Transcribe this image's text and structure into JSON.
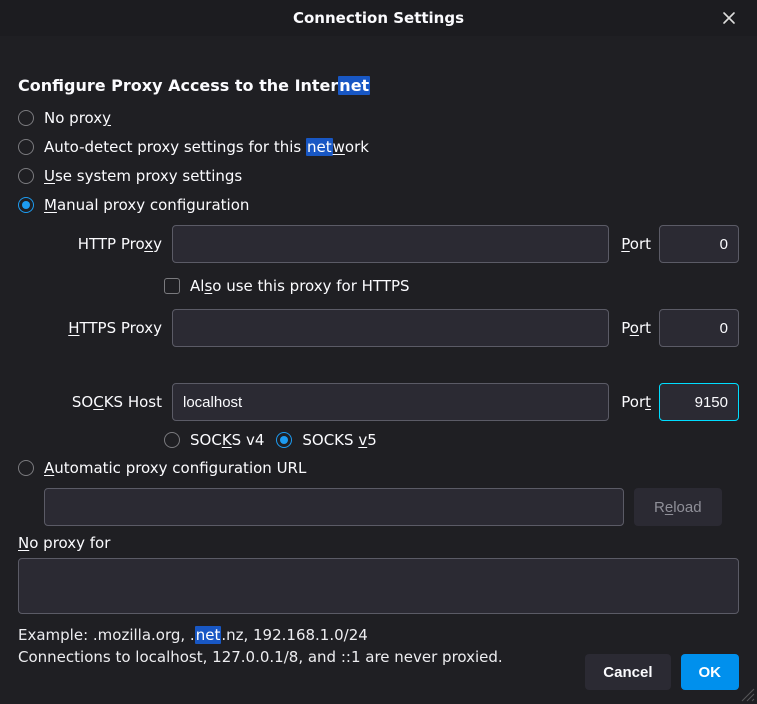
{
  "dialog": {
    "title": "Connection Settings"
  },
  "section": {
    "heading_pre": "Configure Proxy Access to the Inter",
    "heading_hl": "net"
  },
  "options": {
    "no_proxy_pre": "No prox",
    "no_proxy_ul": "y",
    "autodetect_pre": "Auto-detect proxy settings for this ",
    "autodetect_hl": "net",
    "autodetect_ul": "w",
    "autodetect_post": "ork",
    "system_ul": "U",
    "system_post": "se system proxy settings",
    "manual_ul": "M",
    "manual_post": "anual proxy configuration",
    "autoconf_ul": "A",
    "autoconf_post": "utomatic proxy configuration URL"
  },
  "http": {
    "label_pre": "HTTP Pro",
    "label_ul": "x",
    "label_post": "y",
    "value": "",
    "port_label_ul": "P",
    "port_label_post": "ort",
    "port": "0"
  },
  "also_https": {
    "pre": "Al",
    "ul": "s",
    "post": "o use this proxy for HTTPS"
  },
  "https": {
    "label_ul": "H",
    "label_post": "TTPS Proxy",
    "value": "",
    "port_label_pre": "P",
    "port_label_ul": "o",
    "port_label_post": "rt",
    "port": "0"
  },
  "socks": {
    "label_pre": "SO",
    "label_ul": "C",
    "label_post": "KS Host",
    "value": "localhost",
    "port_label_pre": "Por",
    "port_label_ul": "t",
    "port": "9150",
    "v4_pre": "SOC",
    "v4_ul": "K",
    "v4_post": "S v4",
    "v5_pre": "SOCKS ",
    "v5_ul": "v",
    "v5_post": "5"
  },
  "pac": {
    "value": ""
  },
  "reload": {
    "label_pre": "R",
    "label_ul": "e",
    "label_post": "load"
  },
  "noproxy": {
    "label_ul": "N",
    "label_post": "o proxy for",
    "value": ""
  },
  "example": {
    "pre": "Example: .mozilla.org, .",
    "hl": "net",
    "post": ".nz, 192.168.1.0/24"
  },
  "note": "Connections to localhost, 127.0.0.1/8, and ::1 are never proxied.",
  "buttons": {
    "cancel": "Cancel",
    "ok": "OK"
  }
}
